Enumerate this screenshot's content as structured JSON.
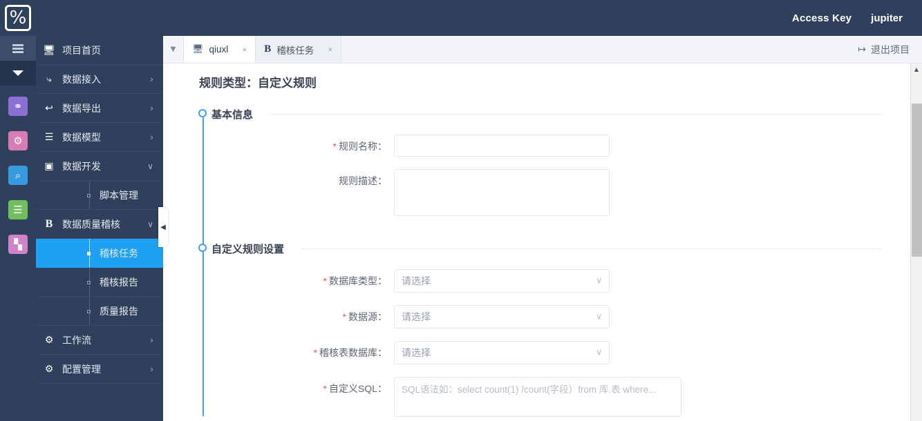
{
  "topbar": {
    "logo_icon": "percent-logo-icon",
    "access_key_label": "Access Key",
    "user_label": "jupiter"
  },
  "rail": {
    "burger_icon": "hamburger-menu-icon",
    "caret_icon": "chevron-down-icon",
    "apps": [
      {
        "name": "shield-app-icon",
        "glyph": "⬡",
        "color": "#8c6fd4"
      },
      {
        "name": "calendar-app-icon",
        "glyph": "⚙",
        "color": "#d97bb5"
      },
      {
        "name": "search-folder-app-icon",
        "glyph": "⌕",
        "color": "#3a9ae0"
      },
      {
        "name": "database-app-icon",
        "glyph": "☰",
        "color": "#72bf5e"
      },
      {
        "name": "chart-app-icon",
        "glyph": "▐",
        "color": "#d183c9"
      }
    ]
  },
  "nav": {
    "items": [
      {
        "label": "项目首页",
        "icon": "monitor-icon",
        "glyph": "⬜",
        "arrow": ""
      },
      {
        "label": "数据接入",
        "icon": "arrow-import-icon",
        "glyph": "↱",
        "arrow": "›"
      },
      {
        "label": "数据导出",
        "icon": "arrow-export-icon",
        "glyph": "↰",
        "arrow": "›"
      },
      {
        "label": "数据模型",
        "icon": "database-icon",
        "glyph": "☰",
        "arrow": "›"
      },
      {
        "label": "数据开发",
        "icon": "code-file-icon",
        "glyph": "▣",
        "arrow": "∨"
      }
    ],
    "dev_sub": {
      "label": "脚本管理",
      "name": "sidebar-item-script-management"
    },
    "quality": {
      "label": "数据质量稽核",
      "icon": "b-letter-icon",
      "glyph": "B",
      "arrow": "∨"
    },
    "quality_subs": [
      {
        "label": "稽核任务",
        "name": "sidebar-item-audit-task",
        "active": true
      },
      {
        "label": "稽核报告",
        "name": "sidebar-item-audit-report",
        "active": false
      },
      {
        "label": "质量报告",
        "name": "sidebar-item-quality-report",
        "active": false
      }
    ],
    "tail": [
      {
        "label": "工作流",
        "icon": "workflow-icon",
        "glyph": "⚙",
        "arrow": "›"
      },
      {
        "label": "配置管理",
        "icon": "gear-icon",
        "glyph": "⚙",
        "arrow": "›"
      }
    ],
    "collapse_icon": "collapse-left-icon",
    "collapse_glyph": "◀"
  },
  "tabs": {
    "toggle_icon": "tab-dropdown-icon",
    "toggle_glyph": "▼",
    "items": [
      {
        "label": "qiuxl",
        "icon": "monitor-icon",
        "glyph": "⬜",
        "serif": false,
        "active": true,
        "close_glyph": "×"
      },
      {
        "label": "稽核任务",
        "icon": "b-letter-icon",
        "glyph": "B",
        "serif": true,
        "active": false,
        "close_glyph": "×"
      }
    ],
    "logout": {
      "label": "退出项目",
      "icon": "logout-icon",
      "glyph": "↪"
    }
  },
  "page": {
    "title": "规则类型：自定义规则"
  },
  "sections": {
    "basic": {
      "title": "基本信息",
      "fields": [
        {
          "name": "rule-name-field",
          "label": "规则名称：",
          "required": true,
          "type": "input",
          "value": "",
          "placeholder": ""
        },
        {
          "name": "rule-description-field",
          "label": "规则描述：",
          "required": false,
          "type": "textarea",
          "value": "",
          "placeholder": ""
        }
      ]
    },
    "custom": {
      "title": "自定义规则设置",
      "fields": [
        {
          "name": "database-type-select",
          "label": "数据库类型：",
          "required": true,
          "type": "select",
          "value": "请选择",
          "chevron": "∨"
        },
        {
          "name": "datasource-select",
          "label": "数据源：",
          "required": true,
          "type": "select",
          "value": "请选择",
          "chevron": "∨"
        },
        {
          "name": "audit-table-database-select",
          "label": "稽核表数据库：",
          "required": true,
          "type": "select",
          "value": "请选择",
          "chevron": "∨"
        },
        {
          "name": "custom-sql-field",
          "label": "自定义SQL：",
          "required": true,
          "type": "textarea-wide",
          "value": "",
          "placeholder": "SQL语法如：select count(1) /count(字段）from 库.表 where..."
        }
      ]
    }
  },
  "scrollbar": {
    "up_glyph": "▲",
    "down_glyph": "▼"
  },
  "colors": {
    "nav_bg": "#2f405c",
    "accent_blue": "#409eff",
    "active_item": "#1da1f2",
    "required_red": "#f05252"
  }
}
